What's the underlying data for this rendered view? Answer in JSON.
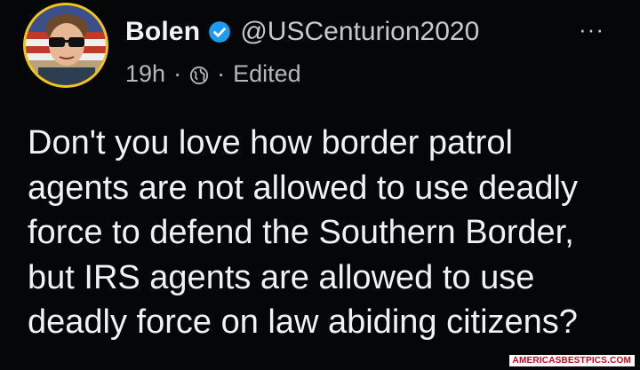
{
  "post": {
    "author_name": "Bolen",
    "handle": "@USCenturion2020",
    "time": "19h",
    "separator": "·",
    "edited_label": "Edited",
    "more_label": "···",
    "text": "Don't you love how border patrol\nagents are not allowed to use deadly\nforce to defend the Southern Border,\nbut IRS agents are allowed to use\ndeadly force on law abiding citizens?"
  },
  "icons": {
    "verified": "verified-badge-icon",
    "audience": "globe-icon",
    "more": "more-options-icon"
  },
  "watermark": {
    "text": "AMERICASBESTPICS.COM"
  },
  "colors": {
    "background": "#050608",
    "verified_badge": "#1d9bf0",
    "avatar_ring": "#f0c419",
    "watermark_text": "#d0021b"
  }
}
